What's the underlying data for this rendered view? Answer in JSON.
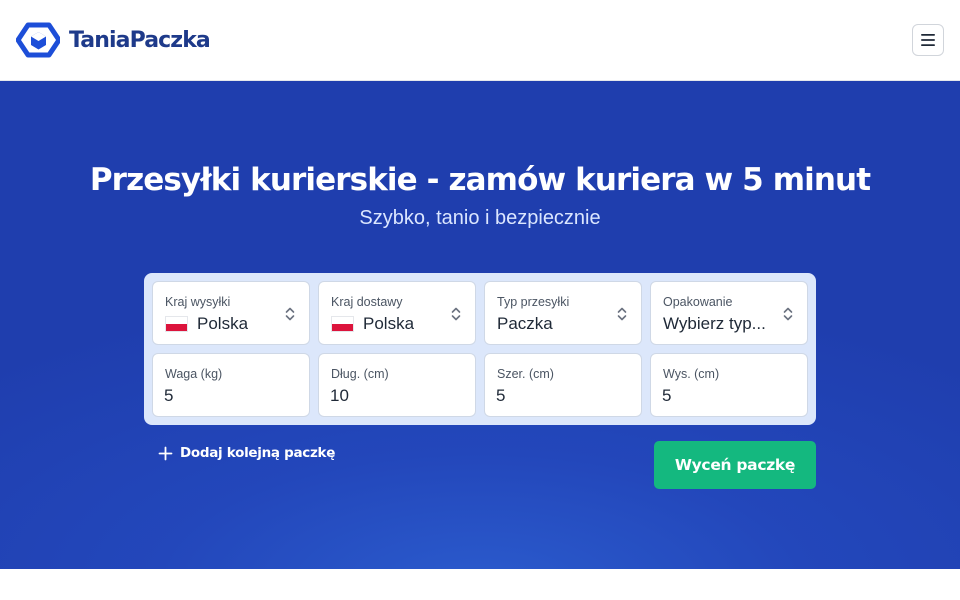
{
  "brand": {
    "name": "TaniaPaczka",
    "color": "#1e3a8a",
    "logo_icon": "hexagon-box-logo"
  },
  "header": {
    "menu_icon": "hamburger-menu-icon"
  },
  "hero": {
    "title": "Przesyłki kurierskie - zamów kuriera w 5 minut",
    "subtitle": "Szybko, tanio i bezpiecznie",
    "background_color": "#2347bb"
  },
  "form": {
    "selects": [
      {
        "label": "Kraj wysyłki",
        "value": "Polska",
        "flag": "PL"
      },
      {
        "label": "Kraj dostawy",
        "value": "Polska",
        "flag": "PL"
      },
      {
        "label": "Typ przesyłki",
        "value": "Paczka"
      },
      {
        "label": "Opakowanie",
        "value": "Wybierz typ..."
      }
    ],
    "inputs": [
      {
        "label": "Waga (kg)",
        "value": "5"
      },
      {
        "label": "Dług. (cm)",
        "value": "10"
      },
      {
        "label": "Szer. (cm)",
        "value": "5"
      },
      {
        "label": "Wys. (cm)",
        "value": "5"
      }
    ],
    "add_parcel_label": "Dodaj kolejną paczkę",
    "submit_label": "Wyceń paczkę",
    "submit_color": "#14b87f"
  }
}
